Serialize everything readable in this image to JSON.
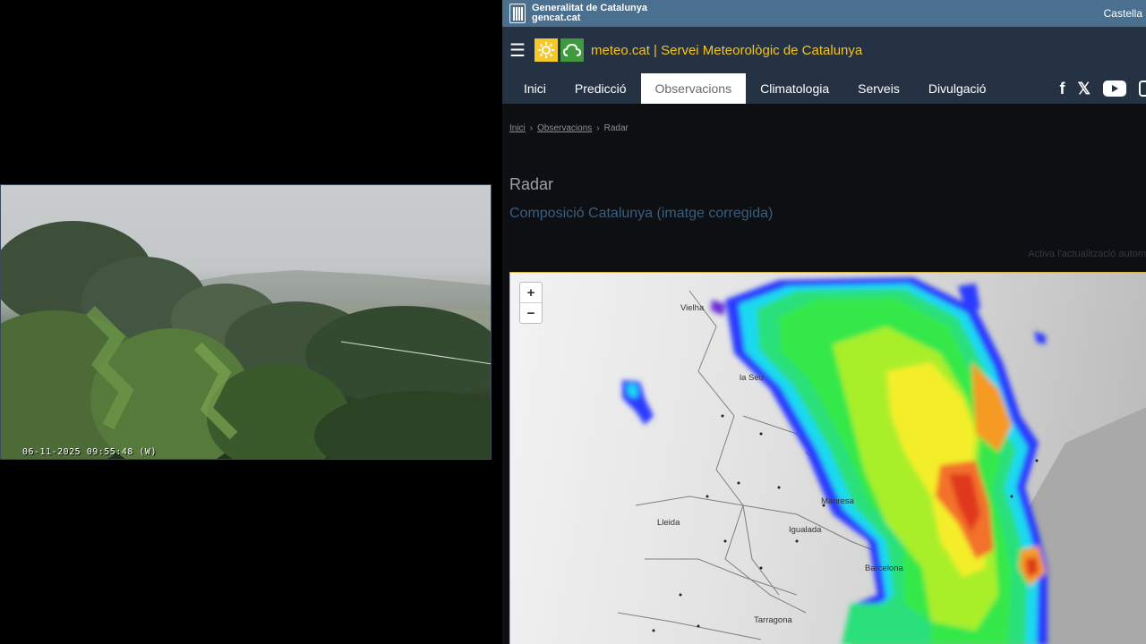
{
  "webcam": {
    "timestamp": "06-11-2025 09:55:48 (W)"
  },
  "topbar": {
    "gencat_line1": "Generalitat de Catalunya",
    "gencat_line2": "gencat.cat",
    "language": "Castella"
  },
  "header": {
    "site_title": "meteo.cat | Servei Meteorològic de Catalunya"
  },
  "nav": {
    "items": [
      "Inici",
      "Predicció",
      "Observacions",
      "Climatologia",
      "Serveis",
      "Divulgació"
    ],
    "active": "Observacions"
  },
  "social": [
    "facebook-icon",
    "x-icon",
    "youtube-icon",
    "instagram-icon"
  ],
  "breadcrumb": {
    "home": "Inici",
    "section": "Observacions",
    "current": "Radar"
  },
  "page": {
    "title": "Radar",
    "subtitle": "Composició Catalunya (imatge corregida)",
    "autorefresh": "Activa l'actualització autom"
  },
  "map": {
    "zoom_in": "+",
    "zoom_out": "−",
    "cities": [
      "Vielha",
      "la Seu",
      "Lleida",
      "Manresa",
      "Igualada",
      "Barcelona",
      "Tarragona"
    ]
  },
  "colors": {
    "accent": "#f7c316",
    "header_bg": "#253243",
    "gencat_bar": "#4a6f8f"
  }
}
